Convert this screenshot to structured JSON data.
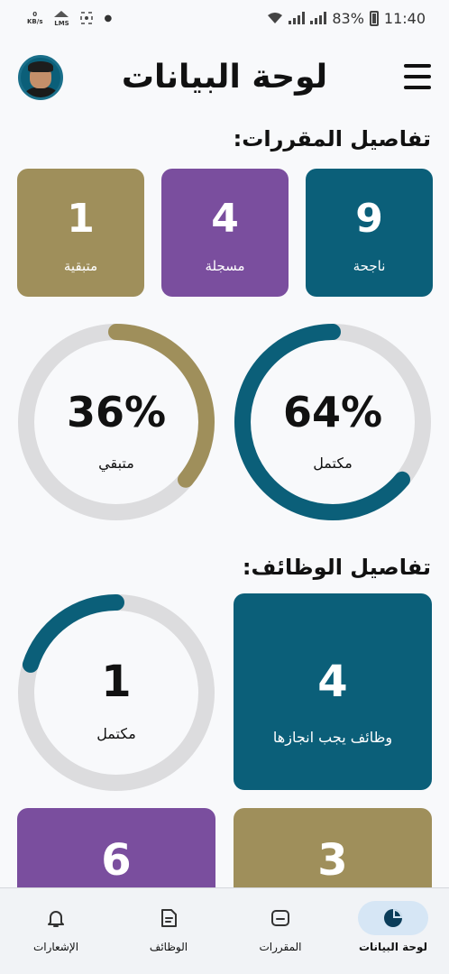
{
  "status_bar": {
    "speed": "0",
    "speed_unit": "KB/s",
    "lms": "LMS",
    "battery": "83%",
    "time": "11:40"
  },
  "header": {
    "title": "لوحة البيانات"
  },
  "courses": {
    "title": "تفاصيل المقررات:",
    "cards": [
      {
        "value": "9",
        "label": "ناجحة",
        "color": "#0b5f79"
      },
      {
        "value": "4",
        "label": "مسجلة",
        "color": "#7a4e9e"
      },
      {
        "value": "1",
        "label": "متبقية",
        "color": "#9f8f5b"
      }
    ],
    "completed": {
      "percent": 64,
      "percent_text": "64%",
      "label": "مكتمل",
      "color": "#0b5f79"
    },
    "remaining": {
      "percent": 36,
      "percent_text": "36%",
      "label": "متبقي",
      "color": "#9f8f5b"
    }
  },
  "tasks": {
    "title": "تفاصيل الوظائف:",
    "due_card": {
      "value": "4",
      "label": "وظائف يجب انجازها",
      "color": "#0b5f79"
    },
    "completed": {
      "value_text": "1",
      "fraction": 0.2,
      "label": "مكتمل",
      "color": "#0b5f79"
    },
    "card_olive": {
      "value": "3"
    },
    "card_purple": {
      "value": "6"
    }
  },
  "bottom_nav": {
    "items": [
      {
        "label": "لوحة البيانات",
        "icon": "pie-chart-icon",
        "active": true
      },
      {
        "label": "المقررات",
        "icon": "folder-icon",
        "active": false
      },
      {
        "label": "الوظائف",
        "icon": "document-icon",
        "active": false
      },
      {
        "label": "الإشعارات",
        "icon": "bell-icon",
        "active": false
      }
    ]
  }
}
